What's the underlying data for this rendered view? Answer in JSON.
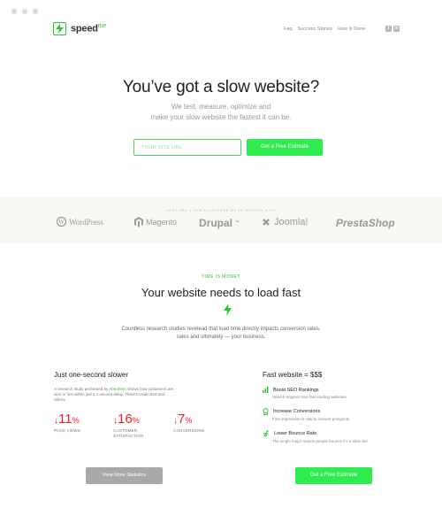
{
  "header": {
    "logo_bold": "speed",
    "logo_light": "me",
    "nav": [
      "Faq",
      "Success Stories",
      "How Is Done"
    ],
    "social": [
      "twitter-icon",
      "linkedin-icon"
    ]
  },
  "hero": {
    "title": "You’ve got a slow website?",
    "subtitle_line1": "We test, measure, optimize and",
    "subtitle_line2": "make your slow website the fastest it can be.",
    "url_placeholder": "YOUR SITE URL",
    "cta_label": "Get a Free Estimate"
  },
  "platforms": {
    "caption": "HERE ARE A FEW PLATFORMS WE'VE WORKED WITH",
    "items": [
      "WordPress",
      "Magento",
      "Drupal",
      "Joomla!",
      "PrestaShop"
    ]
  },
  "section": {
    "tag": "TIME IS MONEY",
    "title": "Your website needs to load fast",
    "subtitle_line1": "Countless research studies revelead that load time directly impacts conversion rates,",
    "subtitle_line2": "sales and ultimately — your business."
  },
  "slower": {
    "title": "Just one-second slower",
    "desc_prefix": "A research study performed by ",
    "desc_link": "Aberdeen",
    "desc_suffix": " shows how customers are won or lost within just a 1 second delay. There's Usain Bolt and others.",
    "stats": [
      {
        "value": "11",
        "unit": "%",
        "label_line1": "PAGE VIEWS",
        "label_line2": ""
      },
      {
        "value": "16",
        "unit": "%",
        "label_line1": "CUSTOMER",
        "label_line2": "SATISFACTION"
      },
      {
        "value": "7",
        "unit": "%",
        "label_line1": "CONVERSIONS",
        "label_line2": ""
      }
    ],
    "button_label": "View More Statistics"
  },
  "fast": {
    "title": "Fast website = $$$",
    "features": [
      {
        "icon": "bar-chart-icon",
        "title": "Boost SEO Rankings",
        "desc": "Search engines love fast loading websites"
      },
      {
        "icon": "badge-icon",
        "title": "Increase Conversions",
        "desc": "First impression is vital to convert prospects"
      },
      {
        "icon": "runner-icon",
        "title": "Lower Bounce Rate",
        "desc": "The single major reason people bounce it's a slow site"
      }
    ],
    "button_label": "Get a Free Estimate"
  },
  "colors": {
    "accent": "#2eec4e",
    "brand_green": "#2dc33a",
    "negative": "#e8202a"
  }
}
